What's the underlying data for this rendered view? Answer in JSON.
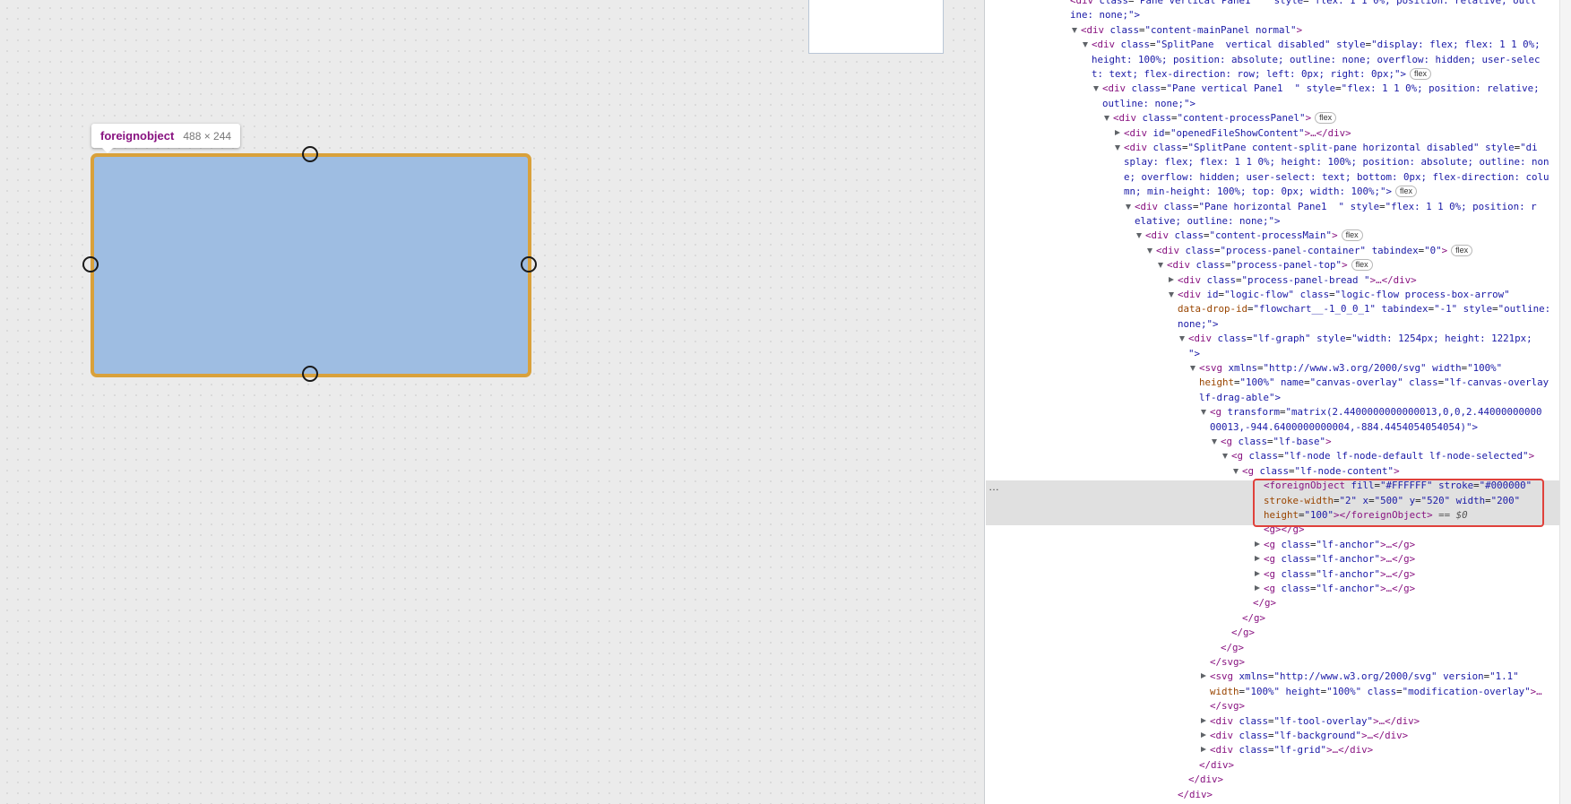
{
  "tooltip": {
    "name": "foreignobject",
    "size": "488 × 244"
  },
  "node": {
    "fill_color": "#9ebde2",
    "border_color": "#d9a13b"
  },
  "dom_tree": [
    {
      "indent": 95,
      "twisty": "none",
      "text": "<div class=\"Pane vertical Pane1  \" style=\"flex: 1 1 0%; position: relative; outl",
      "cls": "tg"
    },
    {
      "indent": 95,
      "twisty": "none",
      "text": "ine: none;\">",
      "cls": "tg"
    },
    {
      "indent": 107,
      "twisty": "open",
      "text": "<div class=\"content-mainPanel normal\">",
      "cls": "tg"
    },
    {
      "indent": 119,
      "twisty": "open",
      "text": "<div class=\"SplitPane  vertical disabled\" style=\"display: flex; flex: 1 1 0%;",
      "cls": "tg"
    },
    {
      "indent": 119,
      "twisty": "none",
      "text": "height: 100%; position: absolute; outline: none; overflow: hidden; user-selec",
      "cls": "tg"
    },
    {
      "indent": 119,
      "twisty": "none",
      "text": "t: text; flex-direction: row; left: 0px; right: 0px;\">",
      "cls": "tg",
      "flex": true
    },
    {
      "indent": 131,
      "twisty": "open",
      "text": "<div class=\"Pane vertical Pane1  \" style=\"flex: 1 1 0%; position: relative;",
      "cls": "tg"
    },
    {
      "indent": 131,
      "twisty": "none",
      "text": "outline: none;\">",
      "cls": "tg"
    },
    {
      "indent": 143,
      "twisty": "open",
      "text": "<div class=\"content-processPanel\">",
      "cls": "tg",
      "flex": true
    },
    {
      "indent": 155,
      "twisty": "closed",
      "text": "<div id=\"openedFileShowContent\">…</div>",
      "cls": "tg"
    },
    {
      "indent": 155,
      "twisty": "open",
      "text": "<div class=\"SplitPane content-split-pane horizontal disabled\" style=\"di",
      "cls": "tg"
    },
    {
      "indent": 155,
      "twisty": "none",
      "text": "splay: flex; flex: 1 1 0%; height: 100%; position: absolute; outline: non",
      "cls": "tg"
    },
    {
      "indent": 155,
      "twisty": "none",
      "text": "e; overflow: hidden; user-select: text; bottom: 0px; flex-direction: colu",
      "cls": "tg"
    },
    {
      "indent": 155,
      "twisty": "none",
      "text": "mn; min-height: 100%; top: 0px; width: 100%;\">",
      "cls": "tg",
      "flex": true
    },
    {
      "indent": 167,
      "twisty": "open",
      "text": "<div class=\"Pane horizontal Pane1  \" style=\"flex: 1 1 0%; position: r",
      "cls": "tg"
    },
    {
      "indent": 167,
      "twisty": "none",
      "text": "elative; outline: none;\">",
      "cls": "tg"
    },
    {
      "indent": 179,
      "twisty": "open",
      "text": "<div class=\"content-processMain\">",
      "cls": "tg",
      "flex": true
    },
    {
      "indent": 191,
      "twisty": "open",
      "text": "<div class=\"process-panel-container\" tabindex=\"0\">",
      "cls": "tg",
      "flex": true
    },
    {
      "indent": 203,
      "twisty": "open",
      "text": "<div class=\"process-panel-top\">",
      "cls": "tg",
      "flex": true
    },
    {
      "indent": 215,
      "twisty": "closed",
      "text": "<div class=\"process-panel-bread \">…</div>",
      "cls": "tg"
    },
    {
      "indent": 215,
      "twisty": "open",
      "text": "<div id=\"logic-flow\" class=\"logic-flow process-box-arrow\"",
      "cls": "tg"
    },
    {
      "indent": 215,
      "twisty": "none",
      "text": "data-drop-id=\"flowchart__-1_0_0_1\" tabindex=\"-1\" style=\"outline:",
      "cls": "tg"
    },
    {
      "indent": 215,
      "twisty": "none",
      "text": "none;\">",
      "cls": "tg"
    },
    {
      "indent": 227,
      "twisty": "open",
      "text": "<div class=\"lf-graph\" style=\"width: 1254px; height: 1221px;",
      "cls": "tg"
    },
    {
      "indent": 227,
      "twisty": "none",
      "text": "\">",
      "cls": "tg"
    },
    {
      "indent": 239,
      "twisty": "open",
      "text": "<svg xmlns=\"http://www.w3.org/2000/svg\" width=\"100%\"",
      "cls": "tg"
    },
    {
      "indent": 239,
      "twisty": "none",
      "text": "height=\"100%\" name=\"canvas-overlay\" class=\"lf-canvas-overlay",
      "cls": "tg"
    },
    {
      "indent": 239,
      "twisty": "none",
      "text": "lf-drag-able\">",
      "cls": "tg"
    },
    {
      "indent": 251,
      "twisty": "open",
      "text": "<g transform=\"matrix(2.4400000000000013,0,0,2.44000000000",
      "cls": "tg"
    },
    {
      "indent": 251,
      "twisty": "none",
      "text": "00013,-944.6400000000004,-884.4454054054054)\">",
      "cls": "tg"
    },
    {
      "indent": 263,
      "twisty": "open",
      "text": "<g class=\"lf-base\">",
      "cls": "tg"
    },
    {
      "indent": 275,
      "twisty": "open",
      "text": "<g class=\"lf-node lf-node-default lf-node-selected\">",
      "cls": "tg"
    },
    {
      "indent": 287,
      "twisty": "open",
      "text": "<g class=\"lf-node-content\">",
      "cls": "tg"
    },
    {
      "indent": 311,
      "twisty": "none",
      "text": "<foreignObject fill=\"#FFFFFF\" stroke=\"#000000\"",
      "cls": "tg",
      "selected": true
    },
    {
      "indent": 311,
      "twisty": "none",
      "text": "stroke-width=\"2\" x=\"500\" y=\"520\" width=\"200\"",
      "cls": "tg",
      "selected": true
    },
    {
      "indent": 311,
      "twisty": "none",
      "text": "height=\"100\"></foreignObject>",
      "cls": "tg",
      "selected": true,
      "eq": " == $0"
    },
    {
      "indent": 311,
      "twisty": "none",
      "text": "<g></g>",
      "cls": "tg"
    },
    {
      "indent": 311,
      "twisty": "closed",
      "text": "<g class=\"lf-anchor\">…</g>",
      "cls": "tg"
    },
    {
      "indent": 311,
      "twisty": "closed",
      "text": "<g class=\"lf-anchor\">…</g>",
      "cls": "tg"
    },
    {
      "indent": 311,
      "twisty": "closed",
      "text": "<g class=\"lf-anchor\">…</g>",
      "cls": "tg"
    },
    {
      "indent": 311,
      "twisty": "closed",
      "text": "<g class=\"lf-anchor\">…</g>",
      "cls": "tg"
    },
    {
      "indent": 299,
      "twisty": "none",
      "text": "</g>",
      "cls": "tg"
    },
    {
      "indent": 287,
      "twisty": "none",
      "text": "</g>",
      "cls": "tg"
    },
    {
      "indent": 275,
      "twisty": "none",
      "text": "</g>",
      "cls": "tg"
    },
    {
      "indent": 263,
      "twisty": "none",
      "text": "</g>",
      "cls": "tg"
    },
    {
      "indent": 251,
      "twisty": "none",
      "text": "</svg>",
      "cls": "tg"
    },
    {
      "indent": 251,
      "twisty": "closed",
      "text": "<svg xmlns=\"http://www.w3.org/2000/svg\" version=\"1.1\"",
      "cls": "tg"
    },
    {
      "indent": 251,
      "twisty": "none",
      "text": "width=\"100%\" height=\"100%\" class=\"modification-overlay\">…",
      "cls": "tg"
    },
    {
      "indent": 251,
      "twisty": "none",
      "text": "</svg>",
      "cls": "tg"
    },
    {
      "indent": 251,
      "twisty": "closed",
      "text": "<div class=\"lf-tool-overlay\">…</div>",
      "cls": "tg"
    },
    {
      "indent": 251,
      "twisty": "closed",
      "text": "<div class=\"lf-background\">…</div>",
      "cls": "tg"
    },
    {
      "indent": 251,
      "twisty": "closed",
      "text": "<div class=\"lf-grid\">…</div>",
      "cls": "tg"
    },
    {
      "indent": 239,
      "twisty": "none",
      "text": "</div>",
      "cls": "tg"
    },
    {
      "indent": 227,
      "twisty": "none",
      "text": "</div>",
      "cls": "tg"
    },
    {
      "indent": 215,
      "twisty": "none",
      "text": "</div>",
      "cls": "tg"
    }
  ],
  "selected_marker": "…",
  "flex_badge_label": "flex"
}
